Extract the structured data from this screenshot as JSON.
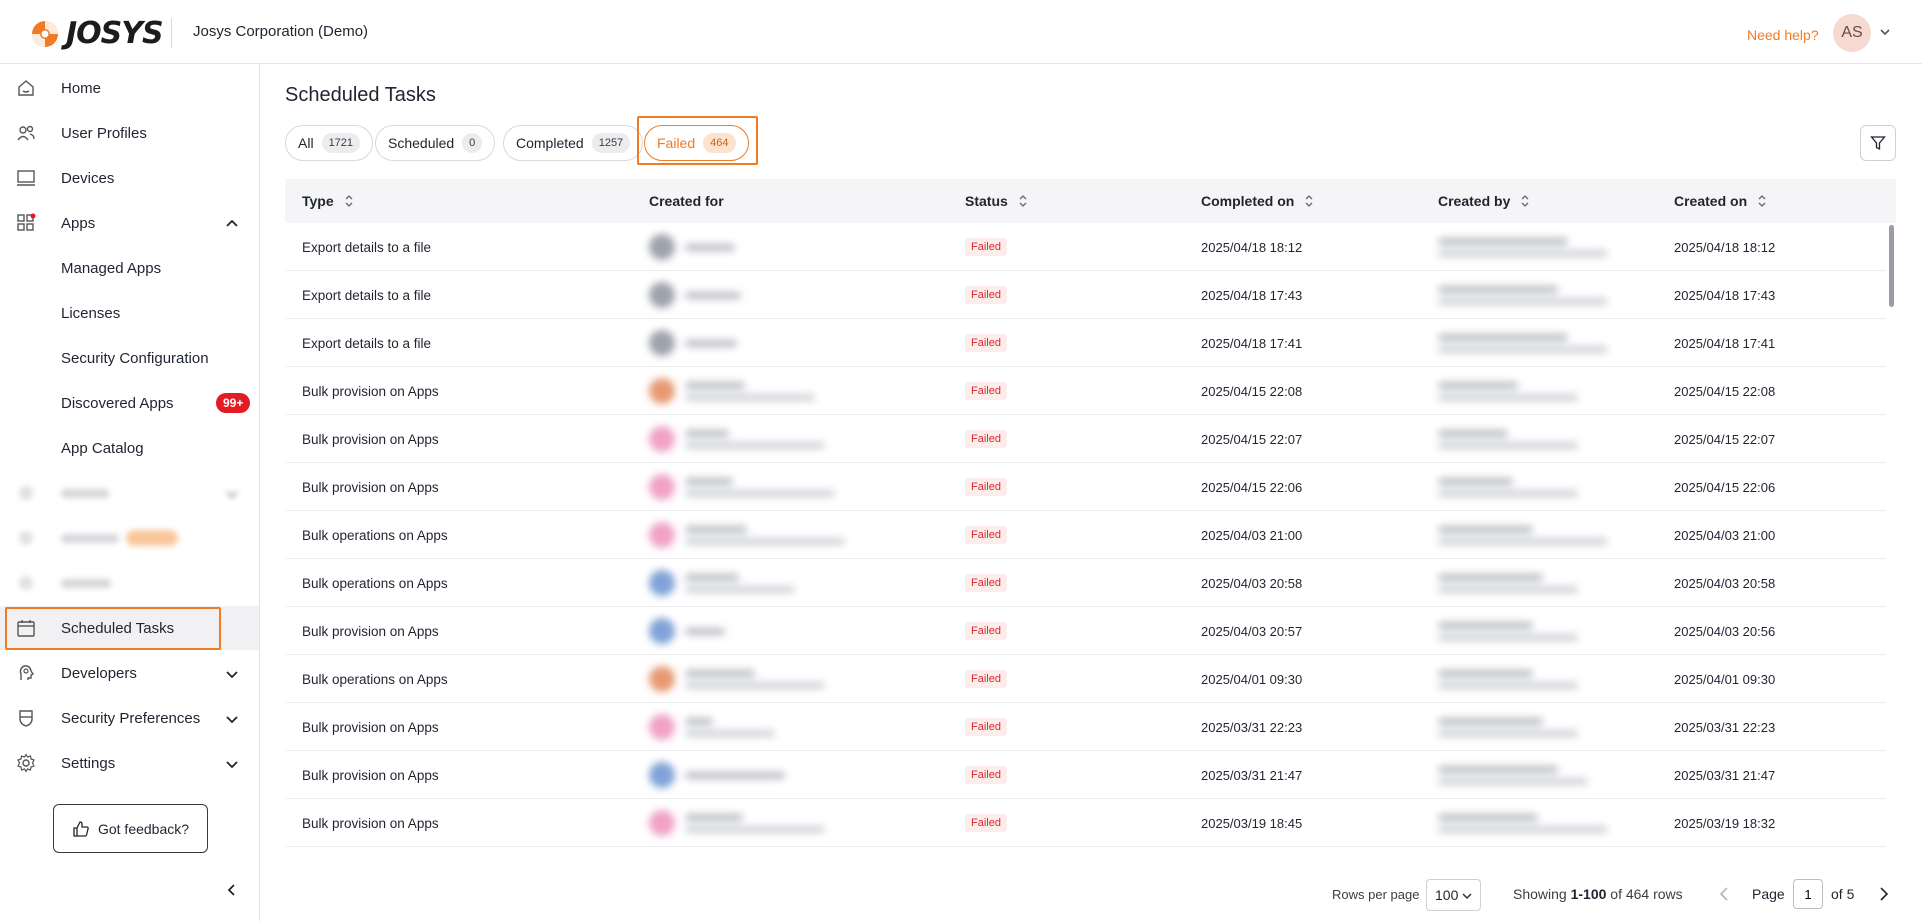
{
  "header": {
    "brand": "JOSYS",
    "org_name": "Josys Corporation (Demo)",
    "help_link": "Need help?",
    "avatar_initials": "AS"
  },
  "sidebar": {
    "items": [
      {
        "label": "Home",
        "icon": "home-icon"
      },
      {
        "label": "User Profiles",
        "icon": "users-icon"
      },
      {
        "label": "Devices",
        "icon": "laptop-icon"
      },
      {
        "label": "Apps",
        "icon": "apps-grid-icon"
      },
      {
        "label": "Managed Apps"
      },
      {
        "label": "Licenses"
      },
      {
        "label": "Security Configuration"
      },
      {
        "label": "Discovered Apps",
        "badge": "99+"
      },
      {
        "label": "App Catalog"
      },
      {
        "label": "Scheduled Tasks",
        "icon": "calendar-icon"
      },
      {
        "label": "Developers",
        "icon": "developer-icon"
      },
      {
        "label": "Security Preferences",
        "icon": "shield-icon"
      },
      {
        "label": "Settings",
        "icon": "gear-icon"
      }
    ],
    "feedback_label": "Got feedback?"
  },
  "main": {
    "title": "Scheduled Tasks",
    "tabs": [
      {
        "label": "All",
        "count": "1721"
      },
      {
        "label": "Scheduled",
        "count": "0"
      },
      {
        "label": "Completed",
        "count": "1257"
      },
      {
        "label": "Failed",
        "count": "464"
      }
    ],
    "active_tab": "Failed",
    "columns": [
      "Type",
      "Created for",
      "Status",
      "Completed on",
      "Created by",
      "Created on"
    ],
    "rows": [
      {
        "type": "Export details to a file",
        "status": "Failed",
        "completed_on": "2025/04/18 18:12",
        "created_on": "2025/04/18 18:12"
      },
      {
        "type": "Export details to a file",
        "status": "Failed",
        "completed_on": "2025/04/18 17:43",
        "created_on": "2025/04/18 17:43"
      },
      {
        "type": "Export details to a file",
        "status": "Failed",
        "completed_on": "2025/04/18 17:41",
        "created_on": "2025/04/18 17:41"
      },
      {
        "type": "Bulk provision on Apps",
        "status": "Failed",
        "completed_on": "2025/04/15 22:08",
        "created_on": "2025/04/15 22:08"
      },
      {
        "type": "Bulk provision on Apps",
        "status": "Failed",
        "completed_on": "2025/04/15 22:07",
        "created_on": "2025/04/15 22:07"
      },
      {
        "type": "Bulk provision on Apps",
        "status": "Failed",
        "completed_on": "2025/04/15 22:06",
        "created_on": "2025/04/15 22:06"
      },
      {
        "type": "Bulk operations on Apps",
        "status": "Failed",
        "completed_on": "2025/04/03 21:00",
        "created_on": "2025/04/03 21:00"
      },
      {
        "type": "Bulk operations on Apps",
        "status": "Failed",
        "completed_on": "2025/04/03 20:58",
        "created_on": "2025/04/03 20:58"
      },
      {
        "type": "Bulk provision on Apps",
        "status": "Failed",
        "completed_on": "2025/04/03 20:57",
        "created_on": "2025/04/03 20:56"
      },
      {
        "type": "Bulk operations on Apps",
        "status": "Failed",
        "completed_on": "2025/04/01 09:30",
        "created_on": "2025/04/01 09:30"
      },
      {
        "type": "Bulk provision on Apps",
        "status": "Failed",
        "completed_on": "2025/03/31 22:23",
        "created_on": "2025/03/31 22:23"
      },
      {
        "type": "Bulk provision on Apps",
        "status": "Failed",
        "completed_on": "2025/03/31 21:47",
        "created_on": "2025/03/31 21:47"
      },
      {
        "type": "Bulk provision on Apps",
        "status": "Failed",
        "completed_on": "2025/03/19 18:45",
        "created_on": "2025/03/19 18:32"
      }
    ]
  },
  "pagination": {
    "rows_per_page_label": "Rows per page",
    "rows_per_page": "100",
    "showing_prefix": "Showing",
    "showing_range": "1-100",
    "showing_suffix": "of 464 rows",
    "page_label": "Page",
    "current_page": "1",
    "of_pages": "of 5"
  },
  "colors": {
    "accent": "#f07b25",
    "failed": "#d6272d",
    "badge": "#e31b23"
  }
}
